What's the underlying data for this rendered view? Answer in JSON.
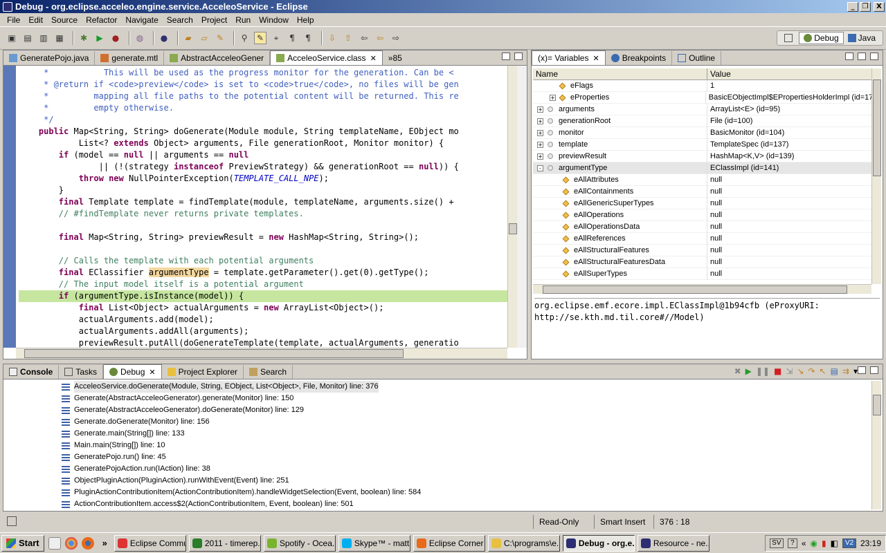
{
  "window": {
    "title": "Debug - org.eclipse.acceleo.engine.service.AcceleoService - Eclipse",
    "minimize_glyph": "_",
    "restore_glyph": "❐",
    "close_glyph": "X"
  },
  "menu": [
    "File",
    "Edit",
    "Source",
    "Refactor",
    "Navigate",
    "Search",
    "Project",
    "Run",
    "Window",
    "Help"
  ],
  "perspectives": [
    {
      "label": "Debug",
      "active": true
    },
    {
      "label": "Java",
      "active": false
    }
  ],
  "editor": {
    "tabs": [
      {
        "label": "GeneratePojo.java",
        "active": false
      },
      {
        "label": "generate.mtl",
        "active": false
      },
      {
        "label": "AbstractAcceleoGener",
        "active": false
      },
      {
        "label": "AcceleoService.class",
        "active": true,
        "close": "✕"
      }
    ],
    "overflow_label": "»85",
    "code_lines": [
      "     *           This will be used as the progress monitor for the generation. Can be <",
      "     * @return if <code>preview</code> is set to <code>true</code>, no files will be gen",
      "     *         mapping all file paths to the potential content will be returned. This re",
      "     *         empty otherwise.",
      "     */",
      "    public Map<String, String> doGenerate(Module module, String templateName, EObject mo",
      "            List<? extends Object> arguments, File generationRoot, Monitor monitor) {",
      "        if (model == null || arguments == null",
      "                || (!(strategy instanceof PreviewStrategy) && generationRoot == null)) {",
      "            throw new NullPointerException(TEMPLATE_CALL_NPE);",
      "        }",
      "        final Template template = findTemplate(module, templateName, arguments.size() +",
      "        // #findTemplate never returns private templates.",
      "",
      "        final Map<String, String> previewResult = new HashMap<String, String>();",
      "",
      "        // Calls the template with each potential arguments",
      "        final EClassifier argumentType = template.getParameter().get(0).getType();",
      "        // The input model itself is a potential argument",
      "        if (argumentType.isInstance(model)) {",
      "            final List<Object> actualArguments = new ArrayList<Object>();",
      "            actualArguments.add(model);",
      "            actualArguments.addAll(arguments);",
      "            previewResult.putAll(doGenerateTemplate(template, actualArguments, generatio"
    ]
  },
  "variables": {
    "tabs": [
      {
        "label": "(x)= Variables",
        "active": true,
        "close": "✕"
      },
      {
        "label": "Breakpoints",
        "active": false
      },
      {
        "label": "Outline",
        "active": false
      }
    ],
    "columns": {
      "name": "Name",
      "value": "Value"
    },
    "rows": [
      {
        "indent": 1,
        "expander": "",
        "icon": "diamond",
        "name": "eFlags",
        "value": "1"
      },
      {
        "indent": 1,
        "expander": "+",
        "icon": "diamond",
        "name": "eProperties",
        "value": "BasicEObjectImpl$EPropertiesHolderImpl  (id=17"
      },
      {
        "indent": 0,
        "expander": "+",
        "icon": "circle",
        "name": "arguments",
        "value": "ArrayList<E>  (id=95)"
      },
      {
        "indent": 0,
        "expander": "+",
        "icon": "circle",
        "name": "generationRoot",
        "value": "File  (id=100)"
      },
      {
        "indent": 0,
        "expander": "+",
        "icon": "circle",
        "name": "monitor",
        "value": "BasicMonitor  (id=104)"
      },
      {
        "indent": 0,
        "expander": "+",
        "icon": "circle",
        "name": "template",
        "value": "TemplateSpec  (id=137)"
      },
      {
        "indent": 0,
        "expander": "+",
        "icon": "circle",
        "name": "previewResult",
        "value": "HashMap<K,V>  (id=139)"
      },
      {
        "indent": 0,
        "expander": "-",
        "icon": "circle",
        "name": "argumentType",
        "value": "EClassImpl  (id=141)",
        "selected": true
      },
      {
        "indent": 2,
        "expander": "",
        "icon": "diamond",
        "name": "eAllAttributes",
        "value": "null"
      },
      {
        "indent": 2,
        "expander": "",
        "icon": "diamond",
        "name": "eAllContainments",
        "value": "null"
      },
      {
        "indent": 2,
        "expander": "",
        "icon": "diamond",
        "name": "eAllGenericSuperTypes",
        "value": "null"
      },
      {
        "indent": 2,
        "expander": "",
        "icon": "diamond",
        "name": "eAllOperations",
        "value": "null"
      },
      {
        "indent": 2,
        "expander": "",
        "icon": "diamond",
        "name": "eAllOperationsData",
        "value": "null"
      },
      {
        "indent": 2,
        "expander": "",
        "icon": "diamond",
        "name": "eAllReferences",
        "value": "null"
      },
      {
        "indent": 2,
        "expander": "",
        "icon": "diamond",
        "name": "eAllStructuralFeatures",
        "value": "null"
      },
      {
        "indent": 2,
        "expander": "",
        "icon": "diamond",
        "name": "eAllStructuralFeaturesData",
        "value": "null"
      },
      {
        "indent": 2,
        "expander": "",
        "icon": "diamond",
        "name": "eAllSuperTypes",
        "value": "null"
      }
    ],
    "detail_lines": [
      "org.eclipse.emf.ecore.impl.EClassImpl@1b94cfb (eProxyURI:",
      "http://se.kth.md.til.core#//Model)"
    ]
  },
  "debug": {
    "tabs": [
      {
        "label": "Console",
        "active": false,
        "bold": true
      },
      {
        "label": "Tasks",
        "active": false
      },
      {
        "label": "Debug",
        "active": true,
        "close": "✕"
      },
      {
        "label": "Project Explorer",
        "active": false
      },
      {
        "label": "Search",
        "active": false
      }
    ],
    "frames": [
      "AcceleoService.doGenerate(Module, String, EObject, List<Object>, File, Monitor) line: 376",
      "Generate(AbstractAcceleoGenerator).generate(Monitor) line: 150",
      "Generate(AbstractAcceleoGenerator).doGenerate(Monitor) line: 129",
      "Generate.doGenerate(Monitor) line: 156",
      "Generate.main(String[]) line: 133",
      "Main.main(String[]) line: 10",
      "GeneratePojo.run() line: 45",
      "GeneratePojoAction.run(IAction) line: 38",
      "ObjectPluginAction(PluginAction).runWithEvent(Event) line: 251",
      "PluginActionContributionItem(ActionContributionItem).handleWidgetSelection(Event, boolean) line: 584",
      "ActionContributionItem.access$2(ActionContributionItem, Event, boolean) line: 501"
    ]
  },
  "status": {
    "mode": "Read-Only",
    "insert": "Smart Insert",
    "position": "376 : 18"
  },
  "taskbar": {
    "start": "Start",
    "more": "»",
    "tasks": [
      {
        "label": "Eclipse Commu...",
        "color": "#d33"
      },
      {
        "label": "2011 - timerep...",
        "color": "#2a7d2a"
      },
      {
        "label": "Spotify - Ocea...",
        "color": "#7ab32e"
      },
      {
        "label": "Skype™ - matt...",
        "color": "#00aff0"
      },
      {
        "label": "Eclipse Corner ...",
        "color": "#e86a1b"
      },
      {
        "label": "C:\\programs\\e...",
        "color": "#e8c040"
      },
      {
        "label": "Debug - org.e...",
        "color": "#2c2d72",
        "active": true
      },
      {
        "label": "Resource - ne...",
        "color": "#2c2d72"
      }
    ],
    "tray": {
      "lang": "SV",
      "help": "?",
      "v2": "V2",
      "clock": "23:19"
    }
  }
}
